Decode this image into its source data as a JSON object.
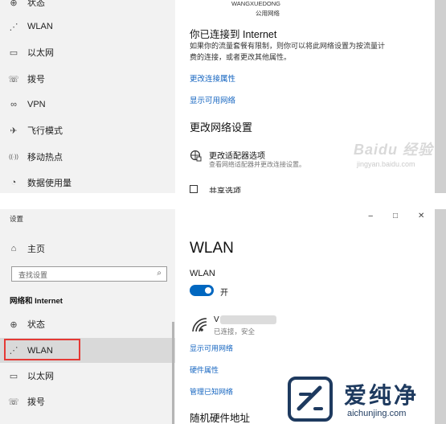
{
  "top": {
    "nav": [
      {
        "icon": "status-icon",
        "glyph": "⊕",
        "label": "状态"
      },
      {
        "icon": "wifi-icon",
        "glyph": "⋰",
        "label": "WLAN"
      },
      {
        "icon": "ethernet-icon",
        "glyph": "▭",
        "label": "以太网"
      },
      {
        "icon": "dialup-icon",
        "glyph": "☏",
        "label": "拨号"
      },
      {
        "icon": "vpn-icon",
        "glyph": "∞",
        "label": "VPN"
      },
      {
        "icon": "airplane-icon",
        "glyph": "✈",
        "label": "飞行模式"
      },
      {
        "icon": "hotspot-icon",
        "glyph": "((·))",
        "label": "移动热点"
      },
      {
        "icon": "data-usage-icon",
        "glyph": "◔",
        "label": "数据使用量"
      }
    ],
    "network_name": "WANGXUEDONG",
    "network_type": "公用网络",
    "connected_title": "你已连接到 Internet",
    "connected_desc_1": "如果你的流量套餐有限制，则你可以将此网络设置为按流量计",
    "connected_desc_2": "费的连接，或者更改其他属性。",
    "link_change_props": "更改连接属性",
    "link_show_networks": "显示可用网络",
    "change_settings_heading": "更改网络设置",
    "adapter_title": "更改适配器选项",
    "adapter_desc": "查看网络适配器并更改连接设置。",
    "share_cut": "共享选项",
    "watermark_main": "Baidu 经验",
    "watermark_sub": "jingyan.baidu.com"
  },
  "bottom": {
    "window_title": "设置",
    "window_controls": {
      "minimize": "−",
      "maximize": "□",
      "close": "✕"
    },
    "home_label": "主页",
    "search_placeholder": "查找设置",
    "category": "网络和 Internet",
    "nav": [
      {
        "icon": "status-icon",
        "glyph": "⊕",
        "label": "状态"
      },
      {
        "icon": "wifi-icon",
        "glyph": "⋰",
        "label": "WLAN"
      },
      {
        "icon": "ethernet-icon",
        "glyph": "▭",
        "label": "以太网"
      },
      {
        "icon": "dialup-icon",
        "glyph": "☏",
        "label": "拨号"
      }
    ],
    "page_title": "WLAN",
    "wlan_label": "WLAN",
    "toggle_state": "开",
    "network_name": "V",
    "network_status": "已连接，安全",
    "link_show_networks": "显示可用网络",
    "link_hardware": "硬件属性",
    "link_manage_known": "管理已知网络",
    "random_hw_heading": "随机硬件地址",
    "accent": "#0067c0",
    "highlight_border": "#e53935"
  },
  "brand": {
    "name": "爱纯净",
    "url": "aichunjing.com"
  }
}
